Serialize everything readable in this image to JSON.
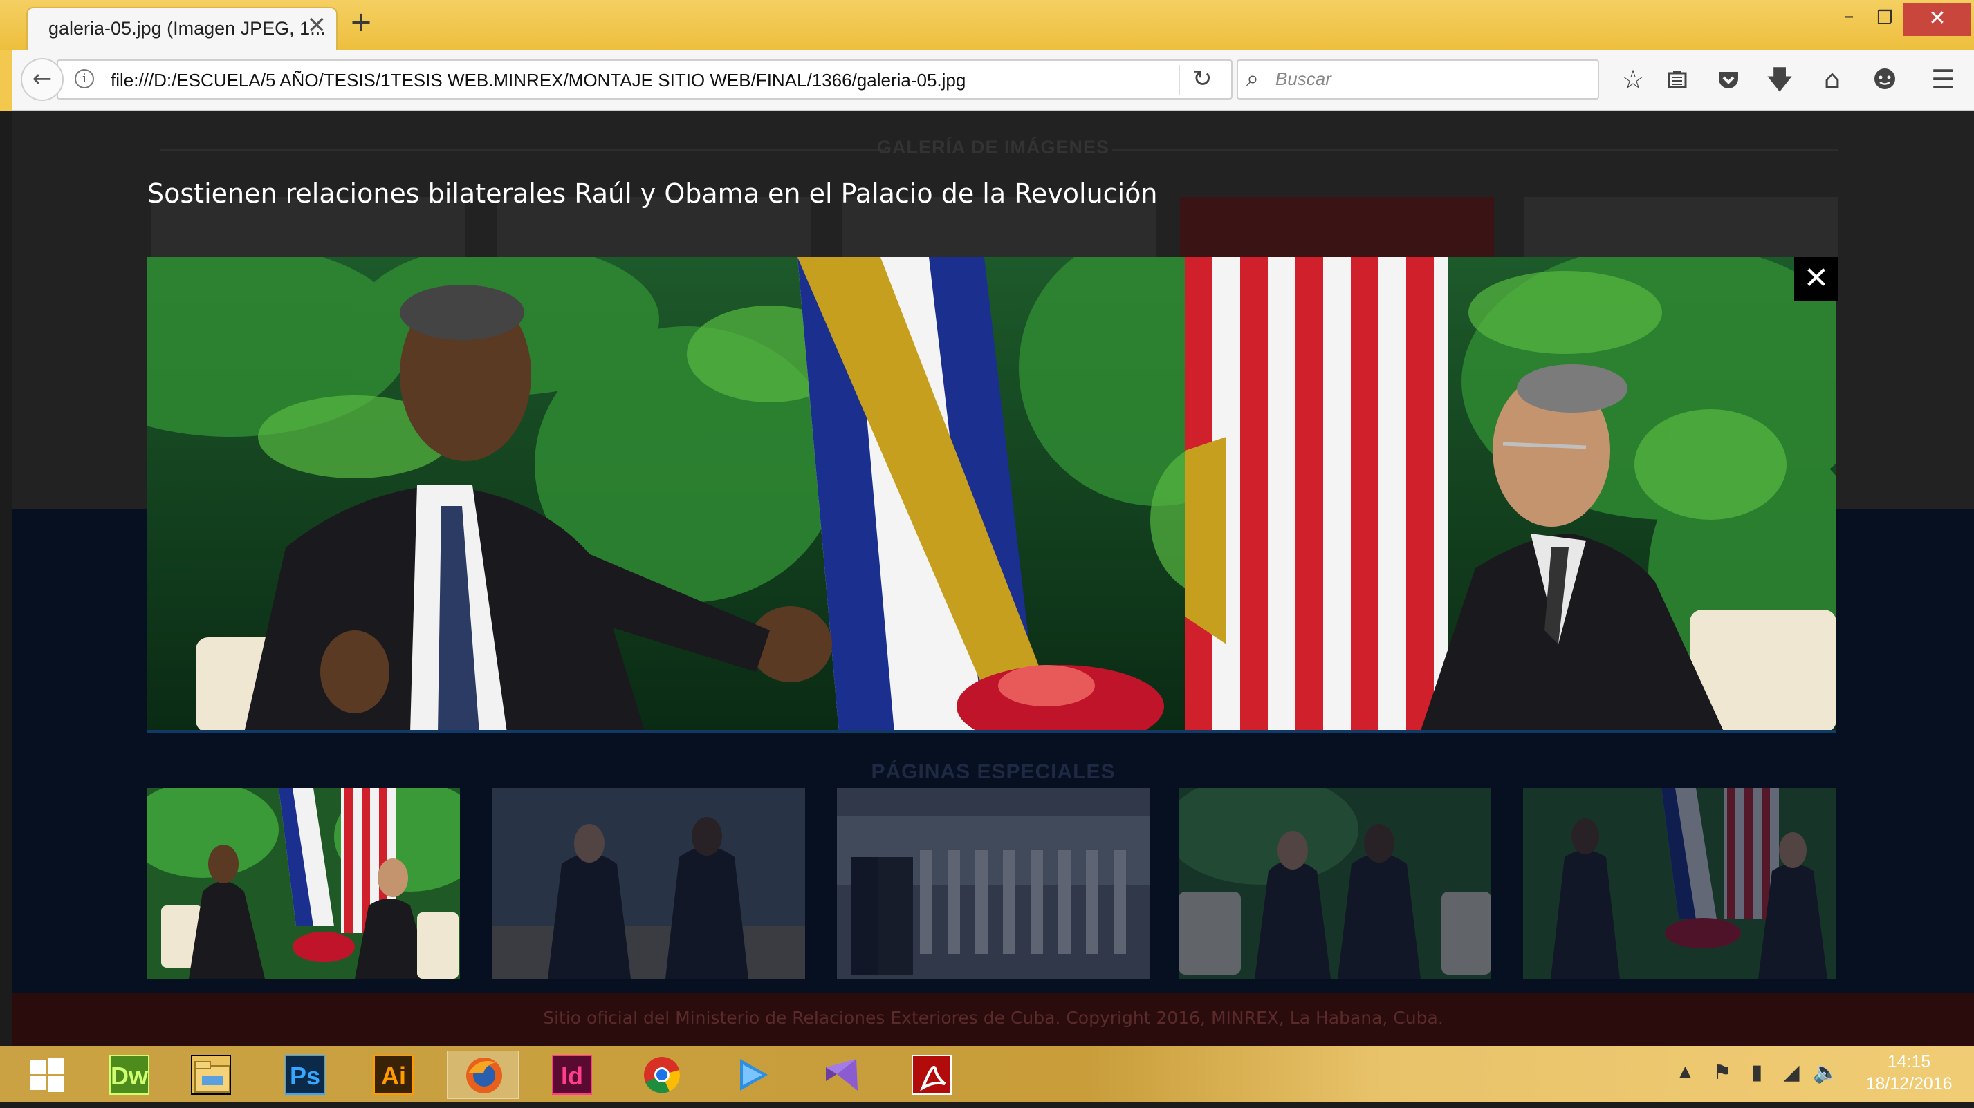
{
  "browser": {
    "tab_title": "galeria-05.jpg (Imagen JPEG, 1...",
    "url": "file:///D:/ESCUELA/5 AÑO/TESIS/1TESIS WEB.MINREX/MONTAJE SITIO WEB/FINAL/1366/galeria-05.jpg",
    "search_placeholder": "Buscar",
    "toolbar_icons": [
      "bookmark-star-icon",
      "reading-list-icon",
      "pocket-icon",
      "download-icon",
      "home-icon",
      "chat-icon",
      "menu-icon"
    ]
  },
  "page": {
    "gallery_heading": "GALERÍA DE IMÁGENES",
    "special_heading": "PÁGINAS ESPECIALES",
    "footer": "Sitio oficial del Ministerio de Relaciones Exteriores de Cuba. Copyright 2016, MINREX, La Habana, Cuba."
  },
  "lightbox": {
    "caption": "Sostienen relaciones bilaterales Raúl y Obama en el Palacio de la Revolución",
    "close_label": "✕",
    "thumbnails": [
      {
        "selected": true
      },
      {
        "selected": false
      },
      {
        "selected": false
      },
      {
        "selected": false
      },
      {
        "selected": false
      }
    ]
  },
  "taskbar": {
    "apps": [
      {
        "label": "Dw",
        "name": "dreamweaver-icon",
        "color": "#4c8b1c",
        "fg": "#cfff70"
      },
      {
        "label": "",
        "name": "file-explorer-icon",
        "color": "#e9c25e",
        "fg": "#000"
      },
      {
        "label": "Ps",
        "name": "photoshop-icon",
        "color": "#0b2a4a",
        "fg": "#37a6ff"
      },
      {
        "label": "Ai",
        "name": "illustrator-icon",
        "color": "#3a2206",
        "fg": "#ff9a00"
      },
      {
        "label": "",
        "name": "firefox-icon",
        "color": "",
        "fg": ""
      },
      {
        "label": "Id",
        "name": "indesign-icon",
        "color": "#5a0a30",
        "fg": "#ff3d8b"
      },
      {
        "label": "",
        "name": "chrome-icon",
        "color": "",
        "fg": ""
      },
      {
        "label": "",
        "name": "media-player-icon",
        "color": "",
        "fg": ""
      },
      {
        "label": "",
        "name": "visual-studio-icon",
        "color": "",
        "fg": ""
      },
      {
        "label": "",
        "name": "acrobat-icon",
        "color": "#b20b0b",
        "fg": "#fff"
      }
    ],
    "clock_time": "14:15",
    "clock_date": "18/12/2016"
  }
}
